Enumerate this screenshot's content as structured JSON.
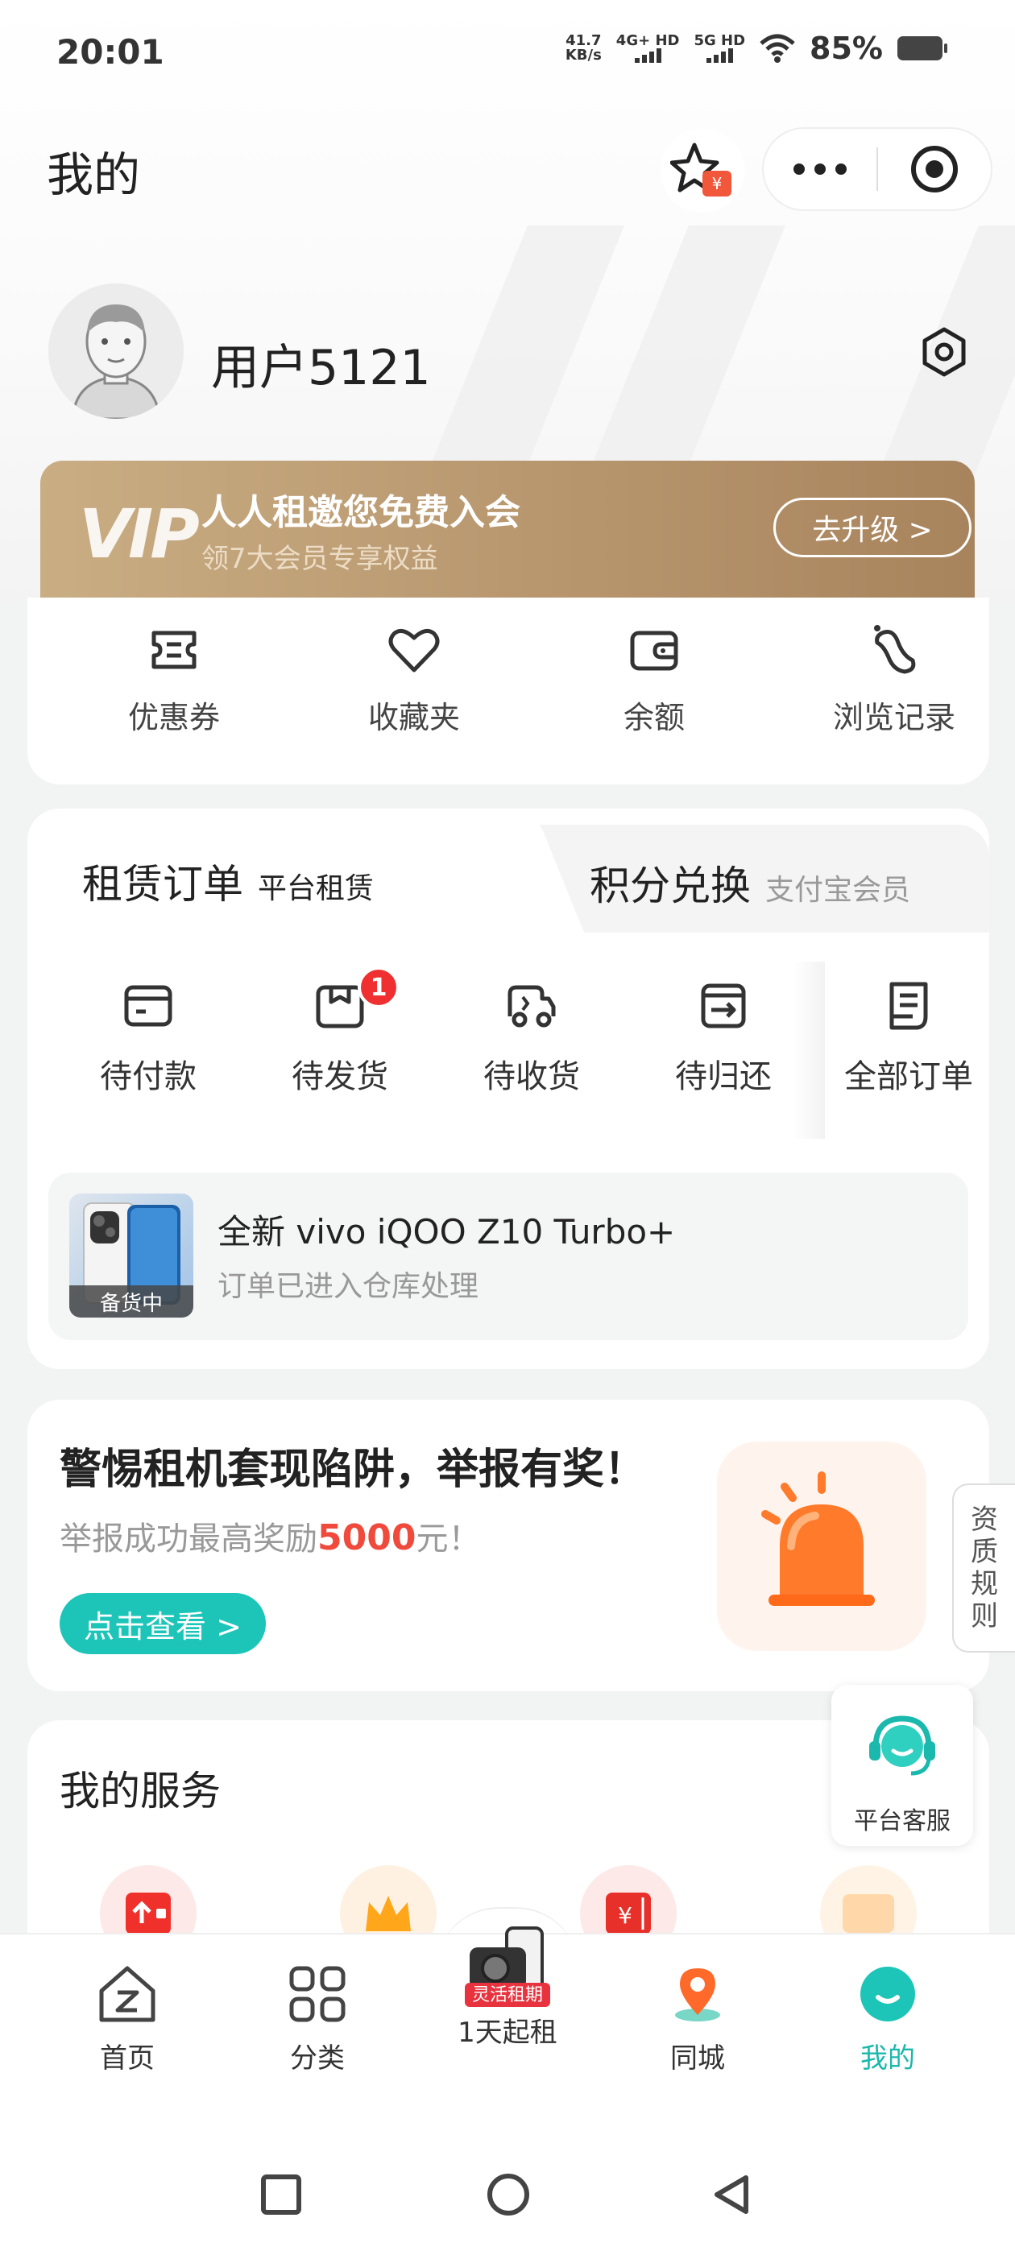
{
  "status_bar": {
    "time": "20:01",
    "net_speed_value": "41.7",
    "net_speed_unit": "KB/s",
    "sim1": "4G+ HD",
    "sim2": "5G HD",
    "battery": "85%"
  },
  "header": {
    "title": "我的",
    "star_badge": "¥"
  },
  "profile": {
    "username": "用户5121"
  },
  "vip": {
    "logo": "VIP",
    "title": "人人租邀您免费入会",
    "subtitle": "领7大会员专享权益",
    "button": "去升级 >"
  },
  "quick_links": [
    {
      "label": "优惠券",
      "icon": "coupon-icon"
    },
    {
      "label": "收藏夹",
      "icon": "heart-icon"
    },
    {
      "label": "余额",
      "icon": "wallet-icon"
    },
    {
      "label": "浏览记录",
      "icon": "footprint-icon"
    }
  ],
  "orders": {
    "tab_active": {
      "label": "租赁订单",
      "sub": "平台租赁"
    },
    "tab_other": {
      "label": "积分兑换",
      "sub": "支付宝会员"
    },
    "items": [
      {
        "label": "待付款",
        "icon": "card-icon",
        "badge": ""
      },
      {
        "label": "待发货",
        "icon": "box-icon",
        "badge": "1"
      },
      {
        "label": "待收货",
        "icon": "truck-icon",
        "badge": ""
      },
      {
        "label": "待归还",
        "icon": "return-icon",
        "badge": ""
      },
      {
        "label": "全部订单",
        "icon": "list-icon",
        "badge": ""
      }
    ],
    "product": {
      "name": "全新 vivo iQOO Z10 Turbo+",
      "status": "订单已进入仓库处理",
      "tag": "备货中"
    }
  },
  "warning": {
    "title": "警惕租机套现陷阱，举报有奖！",
    "desc_prefix": "举报成功最高奖励",
    "desc_amount": "5000",
    "desc_suffix": "元！",
    "button": "点击查看 >"
  },
  "side_tab": [
    "资",
    "质",
    "规",
    "则"
  ],
  "services": {
    "title": "我的服务"
  },
  "customer_service": {
    "label": "平台客服"
  },
  "tabbar": [
    {
      "label": "首页",
      "icon": "home-icon",
      "active": false
    },
    {
      "label": "分类",
      "icon": "category-icon",
      "active": false
    },
    {
      "label": "1天起租",
      "icon": "camera-phone-icon",
      "badge": "灵活租期",
      "active": false
    },
    {
      "label": "同城",
      "icon": "location-icon",
      "active": false
    },
    {
      "label": "我的",
      "icon": "profile-icon",
      "active": true
    }
  ],
  "colors": {
    "accent": "#1bb8ad",
    "vip_gold": "#b99870",
    "badge_red": "#f03030",
    "amount_red": "#ef4a3c"
  }
}
